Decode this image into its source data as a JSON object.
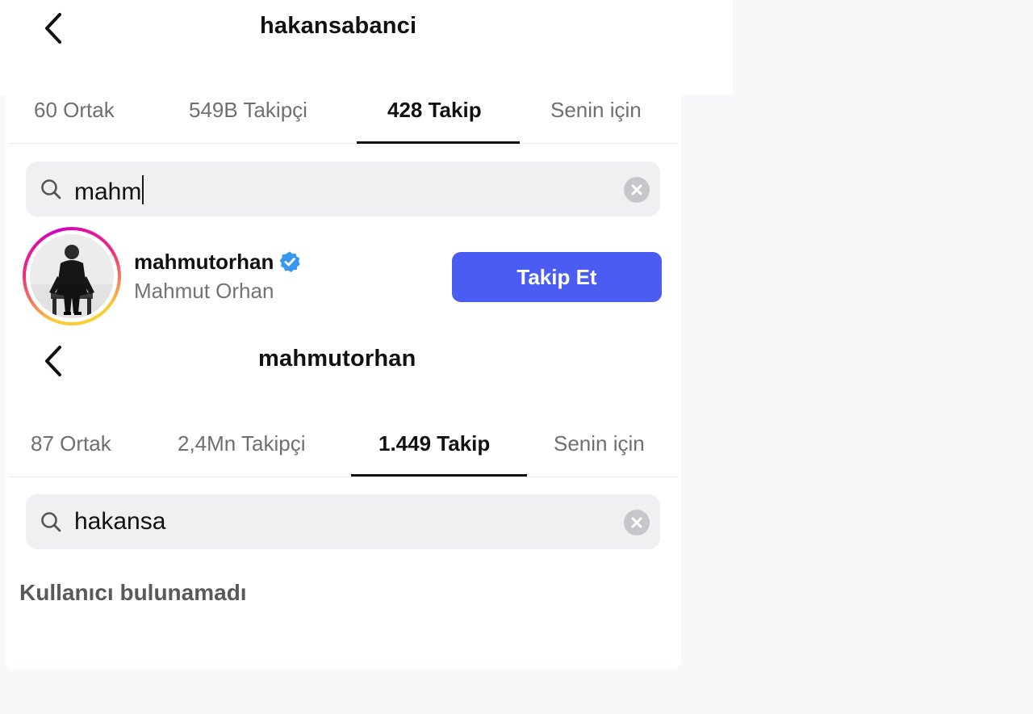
{
  "panel_top": {
    "header": {
      "title": "hakansabanci"
    },
    "tabs": [
      {
        "label": "60 Ortak"
      },
      {
        "label": "549B Takipçi"
      },
      {
        "label": "428 Takip"
      },
      {
        "label": "Senin için"
      }
    ],
    "active_tab": "428 Takip",
    "search": {
      "value": "mahm"
    },
    "result": {
      "username": "mahmutorhan",
      "fullname": "Mahmut Orhan",
      "verified": true,
      "follow_label": "Takip Et"
    }
  },
  "panel_bottom": {
    "header": {
      "title": "mahmutorhan"
    },
    "tabs": [
      {
        "label": "87 Ortak"
      },
      {
        "label": "2,4Mn Takipçi"
      },
      {
        "label": "1.449 Takip"
      },
      {
        "label": "Senin için"
      }
    ],
    "active_tab": "1.449 Takip",
    "search": {
      "value": "hakansa"
    },
    "empty_message": "Kullanıcı bulunamadı"
  },
  "colors": {
    "accent_button": "#4b5cf2",
    "verified_badge": "#3897f0",
    "search_background": "#eff0f2",
    "page_background": "#f7f8fa"
  },
  "icons": {
    "back": "chevron-left-icon",
    "search": "search-icon",
    "clear": "clear-icon",
    "verified": "verified-badge-icon"
  }
}
